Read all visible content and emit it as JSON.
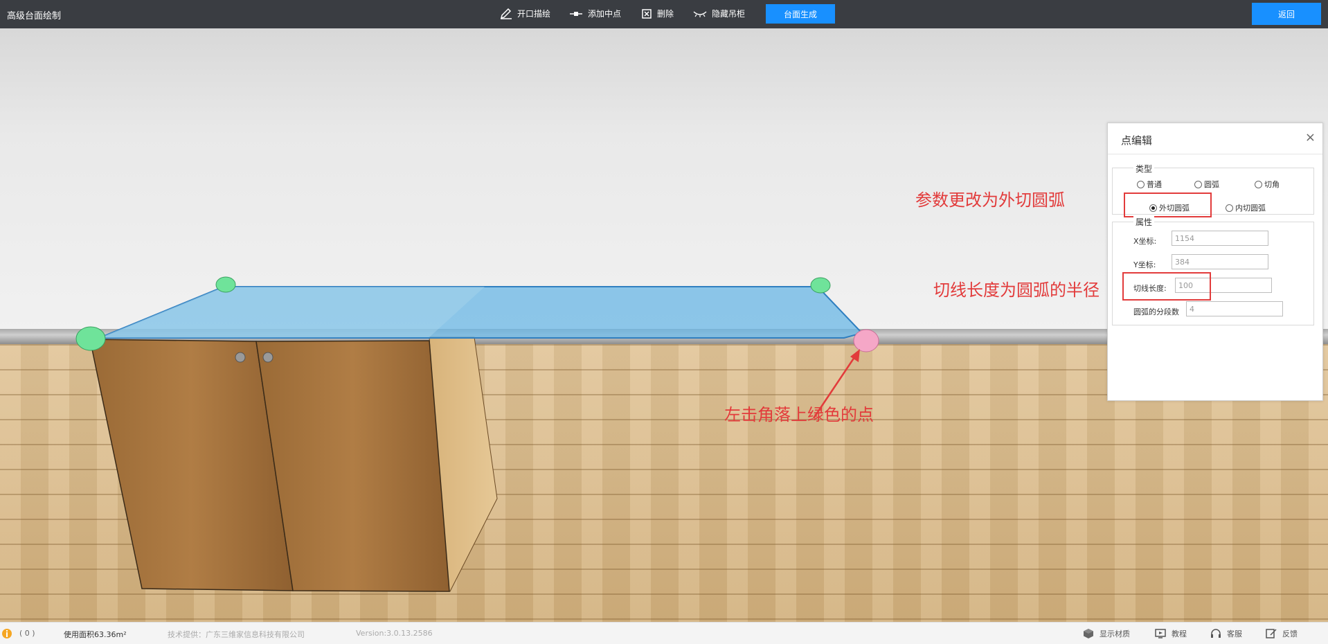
{
  "app": {
    "title": "高级台面绘制"
  },
  "toolbar": {
    "open_cutout": "开口描绘",
    "add_midpoint": "添加中点",
    "delete": "删除",
    "hide_wall_cabinet": "隐藏吊柜",
    "generate": "台面生成",
    "back": "返回"
  },
  "panel": {
    "title": "点编辑",
    "close": "×",
    "type_label": "类型",
    "types": [
      {
        "label": "普通",
        "selected": false
      },
      {
        "label": "圆弧",
        "selected": false
      },
      {
        "label": "切角",
        "selected": false
      },
      {
        "label": "外切圆弧",
        "selected": true
      },
      {
        "label": "内切圆弧",
        "selected": false
      }
    ],
    "props_label": "属性",
    "x_label": "X坐标:",
    "x_value": "1154",
    "y_label": "Y坐标:",
    "y_value": "384",
    "tangent_label": "切线长度:",
    "tangent_value": "100",
    "segments_label": "圆弧的分段数",
    "segments_value": "4"
  },
  "annotations": {
    "change_param": "参数更改为外切圆弧",
    "tangent_radius": "切线长度为圆弧的半径",
    "click_corner": "左击角落上绿色的点"
  },
  "status": {
    "count": "( 0 )",
    "area": "使用面积63.36m²",
    "provider": "技术提供：广东三维家信息科技有限公司",
    "version": "Version:3.0.13.2586",
    "show_material": "显示材质",
    "tutorial": "教程",
    "support": "客服",
    "feedback": "反馈"
  },
  "colors": {
    "topbar": "#3a3d42",
    "primary": "#1890ff",
    "annotation_red": "#e23b3b",
    "countertop": "#6ab7e6",
    "corner_green": "#6fe39a",
    "selected_pink": "#f5a7c7"
  },
  "icons": {
    "status": "info-icon",
    "show_material": "cube-icon",
    "tutorial": "monitor-icon",
    "support": "headset-icon",
    "feedback": "edit-icon"
  }
}
